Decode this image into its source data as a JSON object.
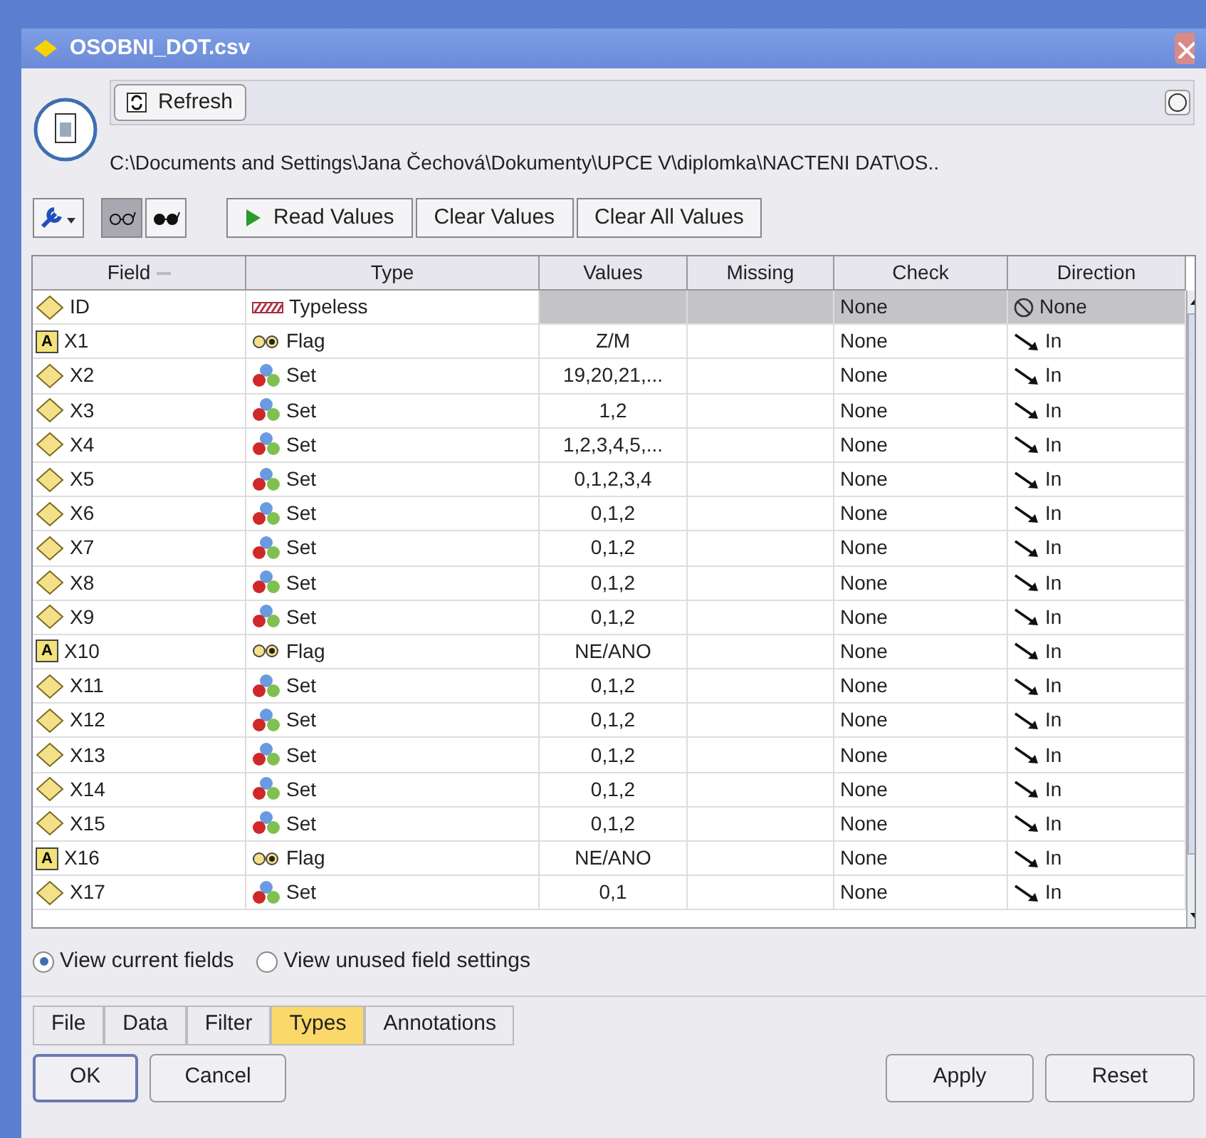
{
  "window": {
    "title": "OSOBNI_DOT.csv"
  },
  "toolbar": {
    "refresh": "Refresh",
    "path": "C:\\Documents and Settings\\Jana Čechová\\Dokumenty\\UPCE V\\diplomka\\NACTENI DAT\\OS..",
    "view_buttons": [
      {
        "selected": true
      },
      {
        "selected": false
      }
    ],
    "actions": [
      "Read Values",
      "Clear Values",
      "Clear All Values"
    ]
  },
  "table": {
    "columns": [
      "Field",
      "Type",
      "Values",
      "Missing",
      "Check",
      "Direction"
    ],
    "rows": [
      {
        "field": "ID",
        "type": {
          "kind": "typeless",
          "label": "Typeless"
        },
        "values": "",
        "check": "None",
        "direction": {
          "kind": "none",
          "label": "None"
        },
        "selected": true
      },
      {
        "field": "X1",
        "icon_letter": "A",
        "type": {
          "kind": "flag",
          "label": "Flag"
        },
        "values": "Z/M",
        "check": "None",
        "direction": {
          "kind": "in",
          "label": "In"
        },
        "selected": false
      },
      {
        "field": "X2",
        "type": {
          "kind": "set",
          "label": "Set"
        },
        "values": "19,20,21,...",
        "check": "None",
        "direction": {
          "kind": "in",
          "label": "In"
        },
        "selected": false
      },
      {
        "field": "X3",
        "type": {
          "kind": "set",
          "label": "Set"
        },
        "values": "1,2",
        "check": "None",
        "direction": {
          "kind": "in",
          "label": "In"
        },
        "selected": false
      },
      {
        "field": "X4",
        "type": {
          "kind": "set",
          "label": "Set"
        },
        "values": "1,2,3,4,5,...",
        "check": "None",
        "direction": {
          "kind": "in",
          "label": "In"
        },
        "selected": false
      },
      {
        "field": "X5",
        "type": {
          "kind": "set",
          "label": "Set"
        },
        "values": "0,1,2,3,4",
        "check": "None",
        "direction": {
          "kind": "in",
          "label": "In"
        },
        "selected": false
      },
      {
        "field": "X6",
        "type": {
          "kind": "set",
          "label": "Set"
        },
        "values": "0,1,2",
        "check": "None",
        "direction": {
          "kind": "in",
          "label": "In"
        },
        "selected": false
      },
      {
        "field": "X7",
        "type": {
          "kind": "set",
          "label": "Set"
        },
        "values": "0,1,2",
        "check": "None",
        "direction": {
          "kind": "in",
          "label": "In"
        },
        "selected": false
      },
      {
        "field": "X8",
        "type": {
          "kind": "set",
          "label": "Set"
        },
        "values": "0,1,2",
        "check": "None",
        "direction": {
          "kind": "in",
          "label": "In"
        },
        "selected": false
      },
      {
        "field": "X9",
        "type": {
          "kind": "set",
          "label": "Set"
        },
        "values": "0,1,2",
        "check": "None",
        "direction": {
          "kind": "in",
          "label": "In"
        },
        "selected": false
      },
      {
        "field": "X10",
        "icon_letter": "A",
        "type": {
          "kind": "flag",
          "label": "Flag"
        },
        "values": "NE/ANO",
        "check": "None",
        "direction": {
          "kind": "in",
          "label": "In"
        },
        "selected": false
      },
      {
        "field": "X11",
        "type": {
          "kind": "set",
          "label": "Set"
        },
        "values": "0,1,2",
        "check": "None",
        "direction": {
          "kind": "in",
          "label": "In"
        },
        "selected": false
      },
      {
        "field": "X12",
        "type": {
          "kind": "set",
          "label": "Set"
        },
        "values": "0,1,2",
        "check": "None",
        "direction": {
          "kind": "in",
          "label": "In"
        },
        "selected": false
      },
      {
        "field": "X13",
        "type": {
          "kind": "set",
          "label": "Set"
        },
        "values": "0,1,2",
        "check": "None",
        "direction": {
          "kind": "in",
          "label": "In"
        },
        "selected": false
      },
      {
        "field": "X14",
        "type": {
          "kind": "set",
          "label": "Set"
        },
        "values": "0,1,2",
        "check": "None",
        "direction": {
          "kind": "in",
          "label": "In"
        },
        "selected": false
      },
      {
        "field": "X15",
        "type": {
          "kind": "set",
          "label": "Set"
        },
        "values": "0,1,2",
        "check": "None",
        "direction": {
          "kind": "in",
          "label": "In"
        },
        "selected": false
      },
      {
        "field": "X16",
        "icon_letter": "A",
        "type": {
          "kind": "flag",
          "label": "Flag"
        },
        "values": "NE/ANO",
        "check": "None",
        "direction": {
          "kind": "in",
          "label": "In"
        },
        "selected": false
      },
      {
        "field": "X17",
        "type": {
          "kind": "set",
          "label": "Set"
        },
        "values": "0,1",
        "check": "None",
        "direction": {
          "kind": "in",
          "label": "In"
        },
        "selected": false
      }
    ]
  },
  "view_options": [
    {
      "label": "View current fields",
      "selected": true
    },
    {
      "label": "View unused field settings",
      "selected": false
    }
  ],
  "tabs": [
    {
      "label": "File",
      "selected": false
    },
    {
      "label": "Data",
      "selected": false
    },
    {
      "label": "Filter",
      "selected": false
    },
    {
      "label": "Types",
      "selected": true
    },
    {
      "label": "Annotations",
      "selected": false
    }
  ],
  "buttons": {
    "left": [
      "OK",
      "Cancel"
    ],
    "right": [
      "Apply",
      "Reset"
    ]
  }
}
